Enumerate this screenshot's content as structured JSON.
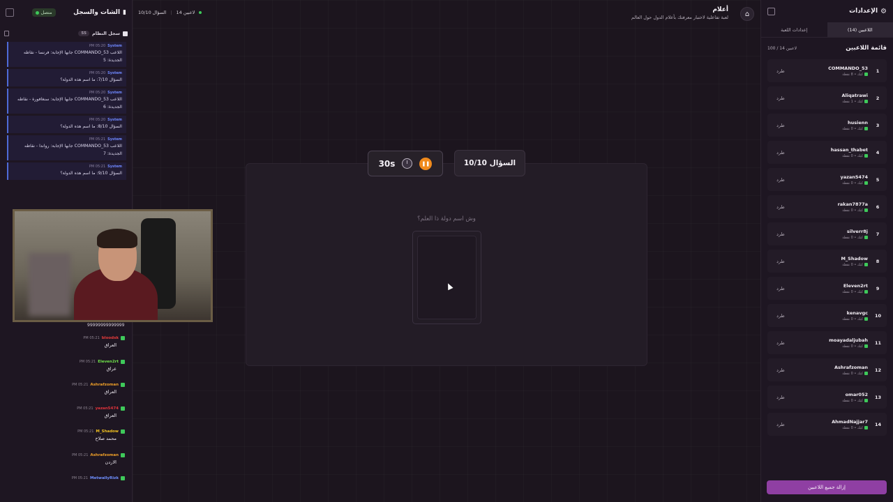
{
  "left_panel": {
    "title": "الشات والسجل",
    "status": "متصل",
    "system_tab": "سجل النظام",
    "system_count": "55",
    "system_messages": [
      {
        "source": "System",
        "time": "PM 05:20",
        "text": "اللاعب COMMANDO_53 جابها الإجابة: فرنسا - نقاطه الجديدة: 5"
      },
      {
        "source": "System",
        "time": "PM 05:20",
        "text": "السؤال 7/10: ما اسم هذه الدولة؟"
      },
      {
        "source": "System",
        "time": "PM 05:20",
        "text": "اللاعب COMMANDO_53 جابها الإجابة: سنغافورة - نقاطه الجديدة: 6"
      },
      {
        "source": "System",
        "time": "PM 05:20",
        "text": "السؤال 8/10: ما اسم هذه الدولة؟"
      },
      {
        "source": "System",
        "time": "PM 05:21",
        "text": "اللاعب COMMANDO_53 جابها الإجابة: رواندا - نقاطه الجديدة: 7"
      },
      {
        "source": "System",
        "time": "PM 05:21",
        "text": "السؤال 9/10: ما اسم هذه الدولة؟"
      }
    ],
    "cam_caption": "99999999999999",
    "chat_messages": [
      {
        "user": "bloodsk",
        "color": "#e53b3b",
        "time": "PM 05:21",
        "text": "العراق"
      },
      {
        "user": "Eleven2rt",
        "color": "#6fe34a",
        "time": "PM 05:21",
        "text": "عراق"
      },
      {
        "user": "Ashrafzoman",
        "color": "#f0a028",
        "time": "PM 05:21",
        "text": "العراق"
      },
      {
        "user": "yazan5474",
        "color": "#e0333b",
        "time": "PM 05:21",
        "text": "العراق"
      },
      {
        "user": "M_Shadow",
        "color": "#f0c020",
        "time": "PM 05:21",
        "text": "محمد صلاح"
      },
      {
        "user": "Ashrafzoman",
        "color": "#f0a028",
        "time": "PM 05:21",
        "text": "الاردن"
      },
      {
        "user": "MetwallyRizk",
        "color": "#6f8fff",
        "time": "PM 05:21",
        "text": ""
      }
    ]
  },
  "top": {
    "players_count": "14 لاعبين",
    "question_label": "السؤال 10/10",
    "game_title": "أعلام",
    "game_subtitle": "لعبة تفاعلية لاختبار معرفتك بأعلام الدول حول العالم"
  },
  "game": {
    "timer": "30s",
    "question_counter": "السؤال 10/10",
    "question_text": "وش اسم دولة ذا العلم؟"
  },
  "right_panel": {
    "title": "الإعدادات",
    "tab_players": "اللاعبين (14)",
    "tab_game_settings": "إعدادات اللعبة",
    "players_heading": "قائمة اللاعبين",
    "players_capacity": "100 / 14 لاعبين",
    "kick_label": "طرد",
    "kick_all": "إزالة جميع اللاعبين",
    "players": [
      {
        "rank": "1",
        "name": "COMMANDO_53",
        "sub": "كيك • 8 نقطة"
      },
      {
        "rank": "2",
        "name": "Aliqatrawi",
        "sub": "كيك • 1 نقطة"
      },
      {
        "rank": "3",
        "name": "husienn",
        "sub": "كيك • 0 نقطة"
      },
      {
        "rank": "4",
        "name": "hassan_thabet",
        "sub": "كيك • 0 نقطة"
      },
      {
        "rank": "5",
        "name": "yazan5474",
        "sub": "كيك • 0 نقطة"
      },
      {
        "rank": "6",
        "name": "rakan7877a",
        "sub": "كيك • 0 نقطة"
      },
      {
        "rank": "7",
        "name": "silverr8j",
        "sub": "كيك • 0 نقطة"
      },
      {
        "rank": "8",
        "name": "M_Shadow",
        "sub": "كيك • 0 نقطة"
      },
      {
        "rank": "9",
        "name": "Eleven2rt",
        "sub": "كيك • 0 نقطة"
      },
      {
        "rank": "10",
        "name": "kenavgc",
        "sub": "كيك • 0 نقطة"
      },
      {
        "rank": "11",
        "name": "moayadaljubah",
        "sub": "كيك • 0 نقطة"
      },
      {
        "rank": "12",
        "name": "Ashrafzoman",
        "sub": "كيك • 0 نقطة"
      },
      {
        "rank": "13",
        "name": "omar052",
        "sub": "كيك • 0 نقطة"
      },
      {
        "rank": "14",
        "name": "AhmadNajjar7",
        "sub": "كيك • 0 نقطة"
      }
    ]
  },
  "colors": {
    "accent_orange": "#f08a1c",
    "kick_all_purple": "#8f3fa3",
    "online_green": "#3ec95a",
    "system_blue": "#4f6bd8"
  },
  "icons": [
    "home-icon",
    "gear-icon",
    "clock-icon",
    "pause-icon",
    "trash-icon",
    "panel-toggle-icon"
  ]
}
